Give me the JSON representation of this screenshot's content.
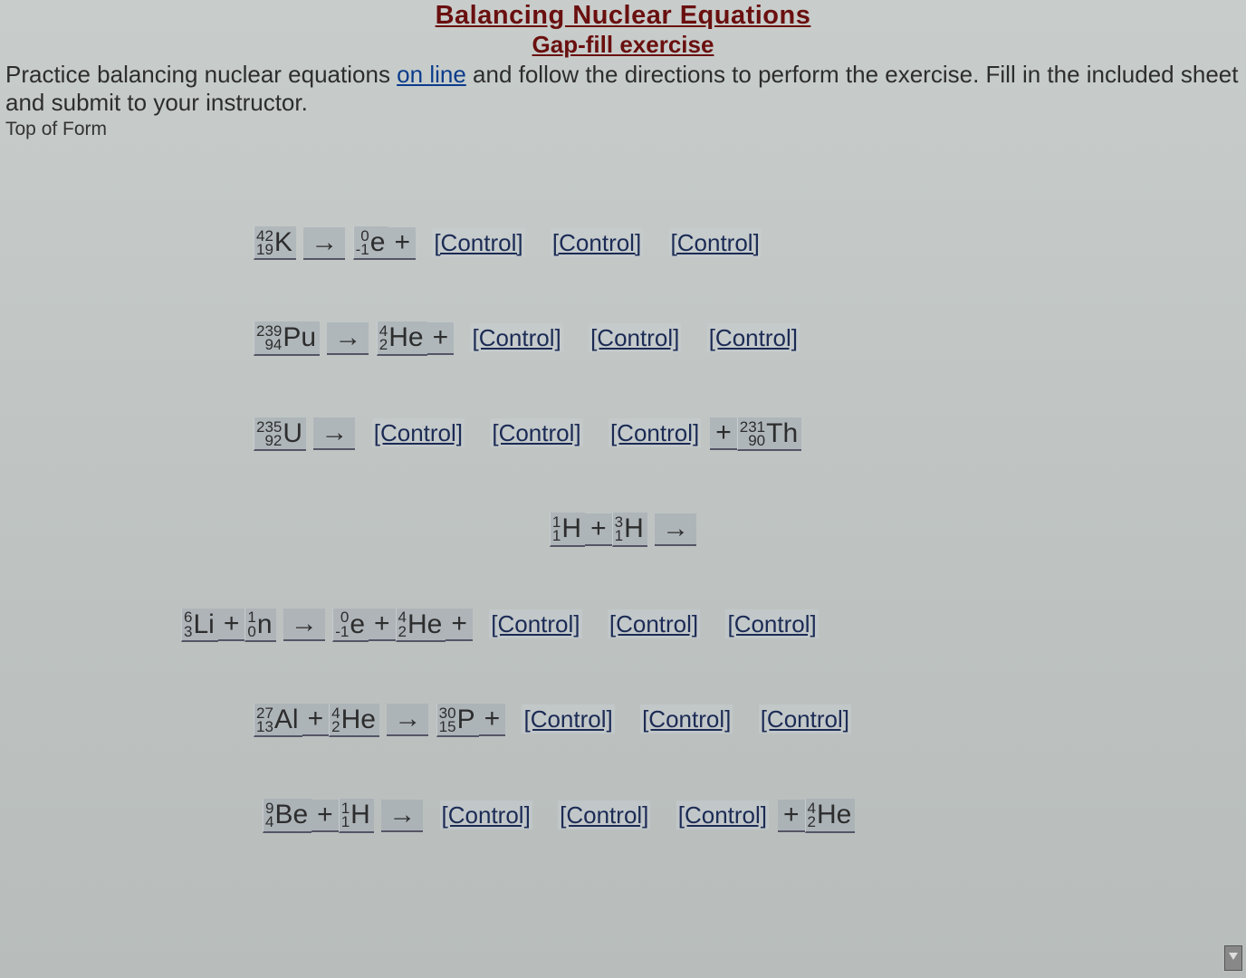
{
  "header": {
    "title": "Balancing Nuclear Equations",
    "subtitle": "Gap-fill exercise"
  },
  "instructions": {
    "part1": "Practice balancing nuclear equations ",
    "link": "on line",
    "part2": " and follow the directions to perform the exercise. Fill in the included sheet and submit to your instructor."
  },
  "top_of_form": "Top of Form",
  "control_label": "[Control]",
  "symbols": {
    "arrow": "→",
    "plus": "+"
  },
  "equations": [
    {
      "lhs": [
        {
          "mass": "42",
          "atomic": "19",
          "sym": "K"
        }
      ],
      "arrow": true,
      "rhs_pre": [
        {
          "mass": "0",
          "atomic": "-1",
          "sym": "e"
        }
      ],
      "rhs_plus": true,
      "controls": 3,
      "tail": null
    },
    {
      "lhs": [
        {
          "mass": "239",
          "atomic": "94",
          "sym": "Pu"
        }
      ],
      "arrow": true,
      "rhs_pre": [
        {
          "mass": "4",
          "atomic": "2",
          "sym": "He"
        }
      ],
      "rhs_plus": true,
      "controls": 3,
      "tail": null
    },
    {
      "lhs": [
        {
          "mass": "235",
          "atomic": "92",
          "sym": "U"
        }
      ],
      "arrow": true,
      "rhs_pre": [],
      "rhs_plus": false,
      "controls": 3,
      "tail": {
        "plus": true,
        "iso": {
          "mass": "231",
          "atomic": "90",
          "sym": "Th"
        }
      }
    },
    {
      "center": true,
      "lhs": [
        {
          "mass": "1",
          "atomic": "1",
          "sym": "H"
        },
        {
          "mass": "3",
          "atomic": "1",
          "sym": "H"
        }
      ],
      "arrow": true,
      "rhs_pre": [],
      "rhs_plus": false,
      "controls": 0,
      "tail": null
    },
    {
      "lhs": [
        {
          "mass": "6",
          "atomic": "3",
          "sym": "Li"
        },
        {
          "mass": "1",
          "atomic": "0",
          "sym": "n"
        }
      ],
      "arrow": true,
      "rhs_pre": [
        {
          "mass": "0",
          "atomic": "-1",
          "sym": "e"
        },
        {
          "mass": "4",
          "atomic": "2",
          "sym": "He"
        }
      ],
      "rhs_plus": true,
      "controls": 3,
      "tail": null
    },
    {
      "lhs": [
        {
          "mass": "27",
          "atomic": "13",
          "sym": "Al"
        },
        {
          "mass": "4",
          "atomic": "2",
          "sym": "He"
        }
      ],
      "arrow": true,
      "rhs_pre": [
        {
          "mass": "30",
          "atomic": "15",
          "sym": "P"
        }
      ],
      "rhs_plus": true,
      "controls": 3,
      "tail": null
    },
    {
      "lhs": [
        {
          "mass": "9",
          "atomic": "4",
          "sym": "Be"
        },
        {
          "mass": "1",
          "atomic": "1",
          "sym": "H"
        }
      ],
      "arrow": true,
      "rhs_pre": [],
      "rhs_plus": false,
      "controls": 3,
      "tail": {
        "plus": true,
        "iso": {
          "mass": "4",
          "atomic": "2",
          "sym": "He"
        }
      }
    }
  ]
}
